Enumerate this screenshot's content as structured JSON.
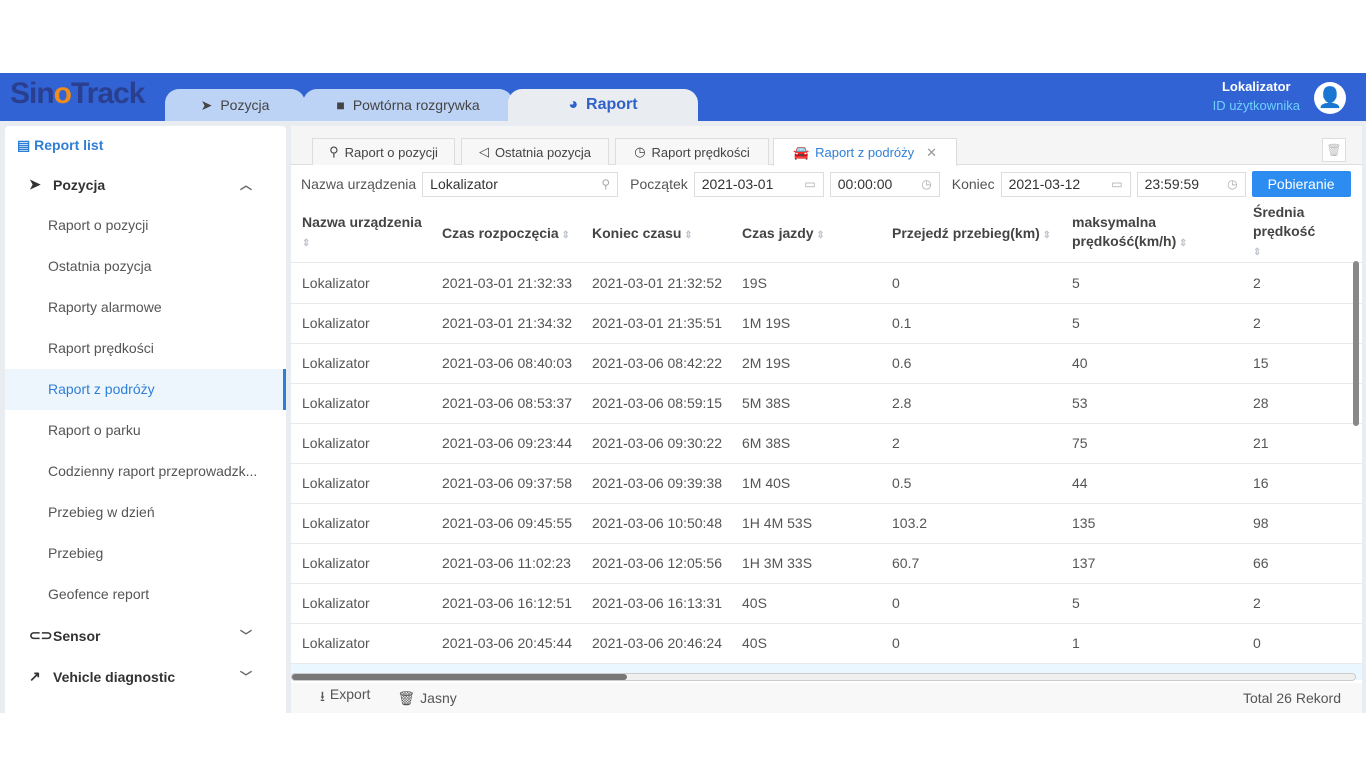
{
  "header": {
    "logo": "SinoTrack",
    "tabs": [
      {
        "label": "Pozycja",
        "icon": "paper-plane-icon"
      },
      {
        "label": "Powtórna rozgrywka",
        "icon": "video-icon"
      },
      {
        "label": "Raport",
        "icon": "pie-chart-icon"
      }
    ],
    "user_name": "Lokalizator",
    "user_id_label": "ID użytkownika"
  },
  "sidebar": {
    "title": "Report list",
    "groups": [
      {
        "label": "Pozycja",
        "items": [
          "Raport o pozycji",
          "Ostatnia pozycja",
          "Raporty alarmowe",
          "Raport prędkości",
          "Raport z podróży",
          "Raport o parku",
          "Codzienny raport przeprowadzk...",
          "Przebieg w dzień",
          "Przebieg",
          "Geofence report"
        ]
      },
      {
        "label": "Sensor"
      },
      {
        "label": "Vehicle diagnostic"
      }
    ],
    "active_item": "Raport z podróży"
  },
  "tabs": [
    "Raport o pozycji",
    "Ostatnia pozycja",
    "Raport prędkości",
    "Raport z podróży"
  ],
  "filters": {
    "device_label": "Nazwa urządzenia",
    "device_value": "Lokalizator",
    "start_label": "Początek",
    "start_date": "2021-03-01",
    "start_time": "00:00:00",
    "end_label": "Koniec",
    "end_date": "2021-03-12",
    "end_time": "23:59:59",
    "submit": "Pobieranie"
  },
  "table": {
    "columns": [
      "Nazwa urządzenia",
      "Czas rozpoczęcia",
      "Koniec czasu",
      "Czas jazdy",
      "Przejedź przebieg(km)",
      "maksymalna prędkość(km/h)",
      "Średnia prędkość"
    ],
    "rows": [
      [
        "Lokalizator",
        "2021-03-01 21:32:33",
        "2021-03-01 21:32:52",
        "19S",
        "0",
        "5",
        "2"
      ],
      [
        "Lokalizator",
        "2021-03-01 21:34:32",
        "2021-03-01 21:35:51",
        "1M 19S",
        "0.1",
        "5",
        "2"
      ],
      [
        "Lokalizator",
        "2021-03-06 08:40:03",
        "2021-03-06 08:42:22",
        "2M 19S",
        "0.6",
        "40",
        "15"
      ],
      [
        "Lokalizator",
        "2021-03-06 08:53:37",
        "2021-03-06 08:59:15",
        "5M 38S",
        "2.8",
        "53",
        "28"
      ],
      [
        "Lokalizator",
        "2021-03-06 09:23:44",
        "2021-03-06 09:30:22",
        "6M 38S",
        "2",
        "75",
        "21"
      ],
      [
        "Lokalizator",
        "2021-03-06 09:37:58",
        "2021-03-06 09:39:38",
        "1M 40S",
        "0.5",
        "44",
        "16"
      ],
      [
        "Lokalizator",
        "2021-03-06 09:45:55",
        "2021-03-06 10:50:48",
        "1H 4M 53S",
        "103.2",
        "135",
        "98"
      ],
      [
        "Lokalizator",
        "2021-03-06 11:02:23",
        "2021-03-06 12:05:56",
        "1H 3M 33S",
        "60.7",
        "137",
        "66"
      ],
      [
        "Lokalizator",
        "2021-03-06 16:12:51",
        "2021-03-06 16:13:31",
        "40S",
        "0",
        "5",
        "2"
      ],
      [
        "Lokalizator",
        "2021-03-06 20:45:44",
        "2021-03-06 20:46:24",
        "40S",
        "0",
        "1",
        "0"
      ]
    ]
  },
  "footer": {
    "export": "Export",
    "clear": "Jasny",
    "total": "Total 26 Rekord"
  }
}
